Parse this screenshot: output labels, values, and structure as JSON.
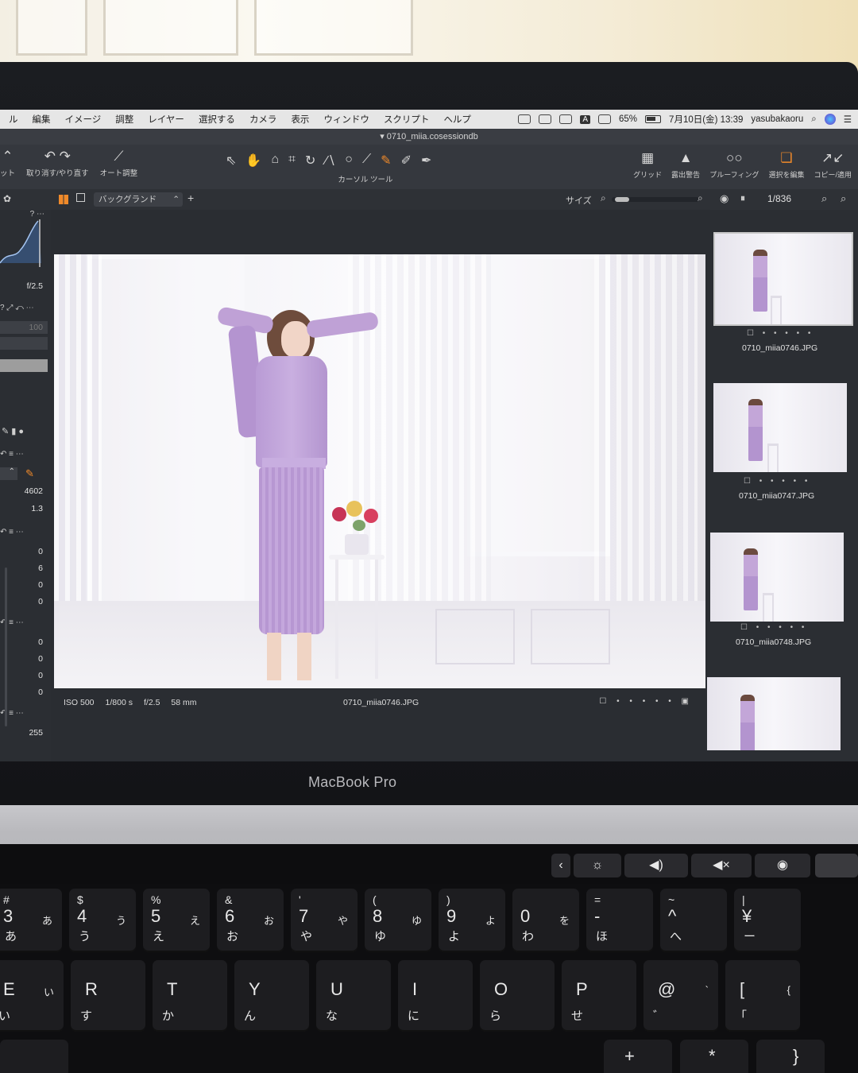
{
  "menubar": {
    "menus": [
      "ル",
      "編集",
      "イメージ",
      "調整",
      "レイヤー",
      "選択する",
      "カメラ",
      "表示",
      "ウィンドウ",
      "スクリプト",
      "ヘルプ"
    ],
    "battery": "65%",
    "datetime": "7月10日(金) 13:39",
    "user": "yasubakaoru"
  },
  "window": {
    "title": "0710_miia.cosessiondb"
  },
  "toolbar": {
    "left_labels": [
      "ット",
      "取り消す/やり直す",
      "オート調整"
    ],
    "cursor_tools_label": "カーソル ツール",
    "right_items": [
      {
        "icon": "grid-icon",
        "label": "グリッド"
      },
      {
        "icon": "warning-icon",
        "label": "露出警告"
      },
      {
        "icon": "glasses-icon",
        "label": "プルーフィング"
      },
      {
        "icon": "layers-icon",
        "label": "選択を編集"
      },
      {
        "icon": "arrows-icon",
        "label": "コピー/適用"
      }
    ]
  },
  "subbar": {
    "layer": "バックグランド",
    "size_label": "サイズ",
    "counter": "1/836"
  },
  "leftpanel": {
    "aperture": "f/2.5",
    "value_100": "100",
    "kelvin": "4602",
    "tint": "1.3",
    "values_a": [
      "0",
      "6",
      "0",
      "0"
    ],
    "values_b": [
      "0",
      "0",
      "0",
      "0"
    ],
    "levels": "255"
  },
  "viewer": {
    "iso": "ISO 500",
    "shutter": "1/800 s",
    "aperture": "f/2.5",
    "focal": "58 mm",
    "filename": "0710_miia0746.JPG",
    "dots": "• • • • •"
  },
  "browser": {
    "thumbs": [
      {
        "name": "0710_miia0746.JPG",
        "dots": "• • • • •"
      },
      {
        "name": "0710_miia0747.JPG",
        "dots": "• • • • •"
      },
      {
        "name": "0710_miia0748.JPG",
        "dots": "• • • • •"
      }
    ]
  },
  "laptop": {
    "model": "MacBook Pro"
  },
  "keyboard": {
    "row1": [
      {
        "top": "#",
        "main": "3",
        "k1": "あ",
        "k2": "あ"
      },
      {
        "top": "$",
        "main": "4",
        "k1": "う",
        "k2": "う"
      },
      {
        "top": "%",
        "main": "5",
        "k1": "え",
        "k2": "え"
      },
      {
        "top": "&",
        "main": "6",
        "k1": "お",
        "k2": "お"
      },
      {
        "top": "'",
        "main": "7",
        "k1": "や",
        "k2": "や"
      },
      {
        "top": "(",
        "main": "8",
        "k1": "ゆ",
        "k2": "ゆ"
      },
      {
        "top": ")",
        "main": "9",
        "k1": "よ",
        "k2": "よ"
      },
      {
        "top": "",
        "main": "0",
        "k1": "を",
        "k2": "わ"
      },
      {
        "top": "=",
        "main": "-",
        "k1": "",
        "k2": "ほ"
      },
      {
        "top": "~",
        "main": "^",
        "k1": "",
        "k2": "へ"
      },
      {
        "top": "|",
        "main": "¥",
        "k1": "",
        "k2": "ー"
      }
    ],
    "row2": [
      {
        "main": "E",
        "k1": "い",
        "k2": "い"
      },
      {
        "main": "R",
        "k1": "",
        "k2": "す"
      },
      {
        "main": "T",
        "k1": "",
        "k2": "か"
      },
      {
        "main": "Y",
        "k1": "",
        "k2": "ん"
      },
      {
        "main": "U",
        "k1": "",
        "k2": "な"
      },
      {
        "main": "I",
        "k1": "",
        "k2": "に"
      },
      {
        "main": "O",
        "k1": "",
        "k2": "ら"
      },
      {
        "main": "P",
        "k1": "",
        "k2": "せ"
      },
      {
        "main": "@",
        "k1": "`",
        "k2": "゛"
      },
      {
        "main": "[",
        "k1": "{",
        "k2": "「"
      }
    ],
    "row3_partial": [
      "+",
      "*",
      "}"
    ]
  },
  "touchbar": {
    "items": [
      "chevron-left-icon",
      "brightness-icon",
      "volume-icon",
      "mute-icon",
      "siri-icon"
    ]
  }
}
